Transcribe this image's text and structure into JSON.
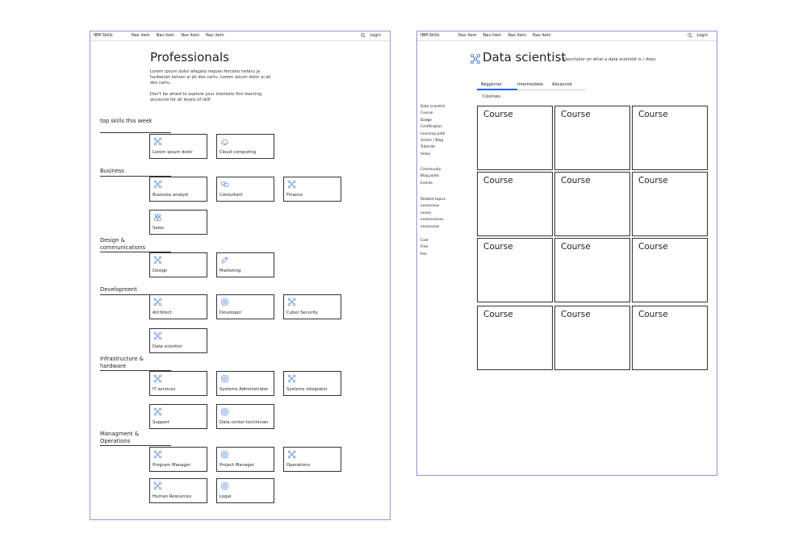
{
  "left": {
    "nav": {
      "brand": "IBM Skills",
      "items": [
        "Nav item",
        "Nav item",
        "Nav item",
        "Nav item"
      ],
      "login": "Login"
    },
    "title": "Professionals",
    "intro": [
      "Lorem ipsum dolor afagato requan fercatio nefaru ja harbanjer kelvan ai jel dos cartu. Lorem ipsum dolor ai jel dos cartu.",
      "Don't be afraid to explore your interests this learning accounts for all levels of skill"
    ],
    "sections": [
      {
        "title": "top skills this week",
        "tiles": [
          {
            "label": "Lorem ipsum dolor",
            "icon": "network-icon"
          },
          {
            "label": "Cloud computing",
            "icon": "cloud-icon"
          }
        ]
      },
      {
        "title": "Business",
        "tiles": [
          {
            "label": "Business analyst",
            "icon": "network-icon"
          },
          {
            "label": "Consultant",
            "icon": "chat-icon"
          },
          {
            "label": "Finance",
            "icon": "network-icon"
          },
          {
            "label": "Sales",
            "icon": "people-icon"
          }
        ]
      },
      {
        "title": "Design & communications",
        "tiles": [
          {
            "label": "Design",
            "icon": "network-icon"
          },
          {
            "label": "Marketing",
            "icon": "pen-icon"
          }
        ]
      },
      {
        "title": "Development",
        "tiles": [
          {
            "label": "Architect",
            "icon": "network-icon"
          },
          {
            "label": "Developer",
            "icon": "target-icon"
          },
          {
            "label": "Cyber Security",
            "icon": "network-icon"
          },
          {
            "label": "Data scientist",
            "icon": "network-icon"
          }
        ]
      },
      {
        "title": "Infrastructure & hardware",
        "tiles": [
          {
            "label": "IT services",
            "icon": "network-icon"
          },
          {
            "label": "Systems Administrator",
            "icon": "target-icon"
          },
          {
            "label": "Systems integrator",
            "icon": "network-icon"
          },
          {
            "label": "Support",
            "icon": "network-icon"
          },
          {
            "label": "Data center technician",
            "icon": "target-icon"
          }
        ]
      },
      {
        "title": "Managment & Operations",
        "tiles": [
          {
            "label": "Program Manager",
            "icon": "network-icon"
          },
          {
            "label": "Project Manager",
            "icon": "target-icon"
          },
          {
            "label": "Operations",
            "icon": "network-icon"
          },
          {
            "label": "Human Resources",
            "icon": "network-icon"
          },
          {
            "label": "Legal",
            "icon": "target-icon"
          }
        ]
      }
    ]
  },
  "right": {
    "nav": {
      "brand": "IBM Skills",
      "items": [
        "Nav item",
        "Nav item",
        "Nav item",
        "Nav item"
      ],
      "login": "Login"
    },
    "title": "Data scientist",
    "descriptor": "Descriptor on what a data scientist is / does",
    "tabs": [
      "Begginner",
      "Intermediate",
      "Advanced"
    ],
    "active_tab": "Begginner",
    "courses_label": "Courses",
    "sidebar_groups": [
      [
        "Data scientist",
        "Course",
        "Badge",
        "Certification",
        "Learning path",
        "Article / Blog",
        "Tutorials",
        "Video"
      ],
      [
        "Community",
        "Blog posts",
        "Events"
      ],
      [
        "Related topics",
        "xxxxxxxxx",
        "xxxxx",
        "xxxxxxxxxxx",
        "xxxxxxxxx"
      ],
      [
        "Cost",
        "Free",
        "Fee"
      ]
    ],
    "course_label": "Course",
    "course_count": 12
  },
  "colors": {
    "frame_border": "#9b8fd6",
    "icon": "#4a7fd6",
    "tab_active": "#0f62fe"
  }
}
